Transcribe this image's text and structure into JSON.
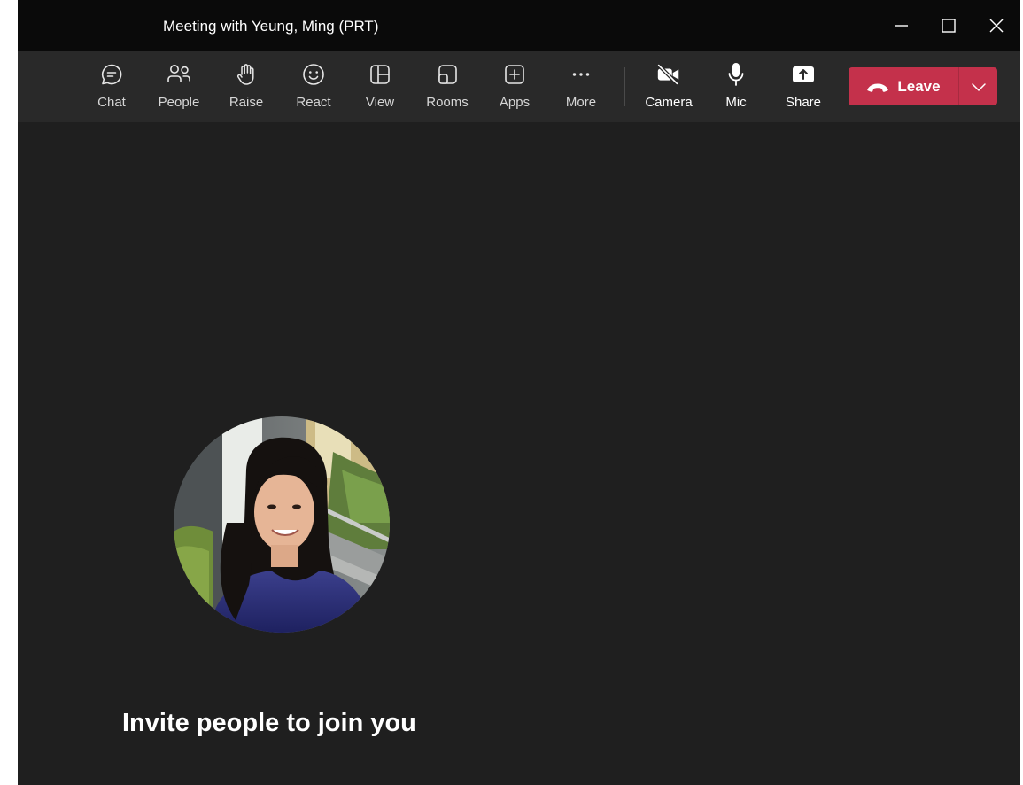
{
  "window": {
    "title": "Meeting with Yeung, Ming (PRT)"
  },
  "toolbar": {
    "items": [
      {
        "label": "Chat",
        "icon": "chat-icon"
      },
      {
        "label": "People",
        "icon": "people-icon"
      },
      {
        "label": "Raise",
        "icon": "raise-hand-icon"
      },
      {
        "label": "React",
        "icon": "smiley-icon"
      },
      {
        "label": "View",
        "icon": "view-grid-icon"
      },
      {
        "label": "Rooms",
        "icon": "rooms-icon"
      },
      {
        "label": "Apps",
        "icon": "plus-box-icon"
      },
      {
        "label": "More",
        "icon": "more-dots-icon"
      },
      {
        "label": "Camera",
        "icon": "camera-off-icon"
      },
      {
        "label": "Mic",
        "icon": "mic-icon"
      },
      {
        "label": "Share",
        "icon": "share-screen-icon"
      }
    ],
    "leave": {
      "label": "Leave",
      "icon": "phone-hangup-icon",
      "color": "#c4314b"
    }
  },
  "stage": {
    "avatar": "participant-avatar",
    "invite_text": "Invite people to join you"
  },
  "colors": {
    "stage_background": "#1f1f1f",
    "toolbar_background": "#292929",
    "titlebar_background": "#0a0a0a"
  }
}
